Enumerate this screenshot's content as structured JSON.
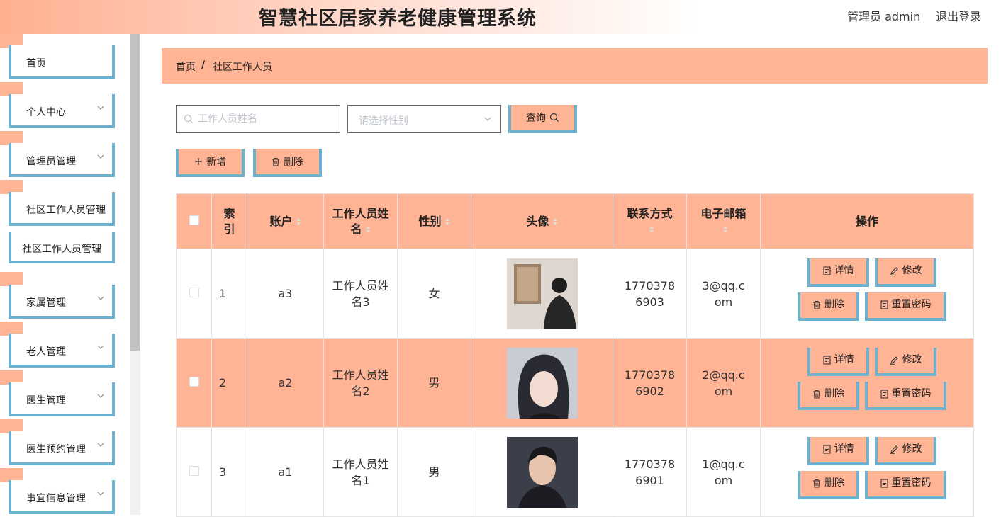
{
  "header": {
    "title": "智慧社区居家养老健康管理系统",
    "user": "管理员 admin",
    "logout": "退出登录"
  },
  "sidebar": {
    "items": [
      {
        "label": "首页",
        "has_arrow": false
      },
      {
        "label": "个人中心",
        "has_arrow": true
      },
      {
        "label": "管理员管理",
        "has_arrow": true
      },
      {
        "label": "社区工作人员管理",
        "has_arrow": false
      },
      {
        "label": "社区工作人员管理",
        "has_arrow": false
      },
      {
        "label": "家属管理",
        "has_arrow": true
      },
      {
        "label": "老人管理",
        "has_arrow": true
      },
      {
        "label": "医生管理",
        "has_arrow": true
      },
      {
        "label": "医生预约管理",
        "has_arrow": true
      },
      {
        "label": "事宜信息管理",
        "has_arrow": true
      }
    ]
  },
  "breadcrumb": {
    "home": "首页",
    "separator": "/",
    "current": "社区工作人员"
  },
  "search": {
    "name_placeholder": "工作人员姓名",
    "gender_placeholder": "请选择性别",
    "query_label": "查询"
  },
  "actions": {
    "add_label": "新增",
    "delete_label": "删除"
  },
  "table": {
    "headers": {
      "index": "索引",
      "account": "账户",
      "name": "工作人员姓名",
      "gender": "性别",
      "avatar": "头像",
      "phone": "联系方式",
      "email": "电子邮箱",
      "ops": "操作"
    },
    "rows": [
      {
        "index": "1",
        "account": "a3",
        "name": "工作人员姓名3",
        "gender": "女",
        "phone": "17703786903",
        "email": "3@qq.com"
      },
      {
        "index": "2",
        "account": "a2",
        "name": "工作人员姓名2",
        "gender": "男",
        "phone": "17703786902",
        "email": "2@qq.com"
      },
      {
        "index": "3",
        "account": "a1",
        "name": "工作人员姓名1",
        "gender": "男",
        "phone": "17703786901",
        "email": "1@qq.com"
      }
    ],
    "row_buttons": {
      "detail": "详情",
      "edit": "修改",
      "delete": "删除",
      "reset": "重置密码"
    }
  },
  "colors": {
    "accent_pink": "#ffb496",
    "accent_blue": "#6cb1cf"
  }
}
